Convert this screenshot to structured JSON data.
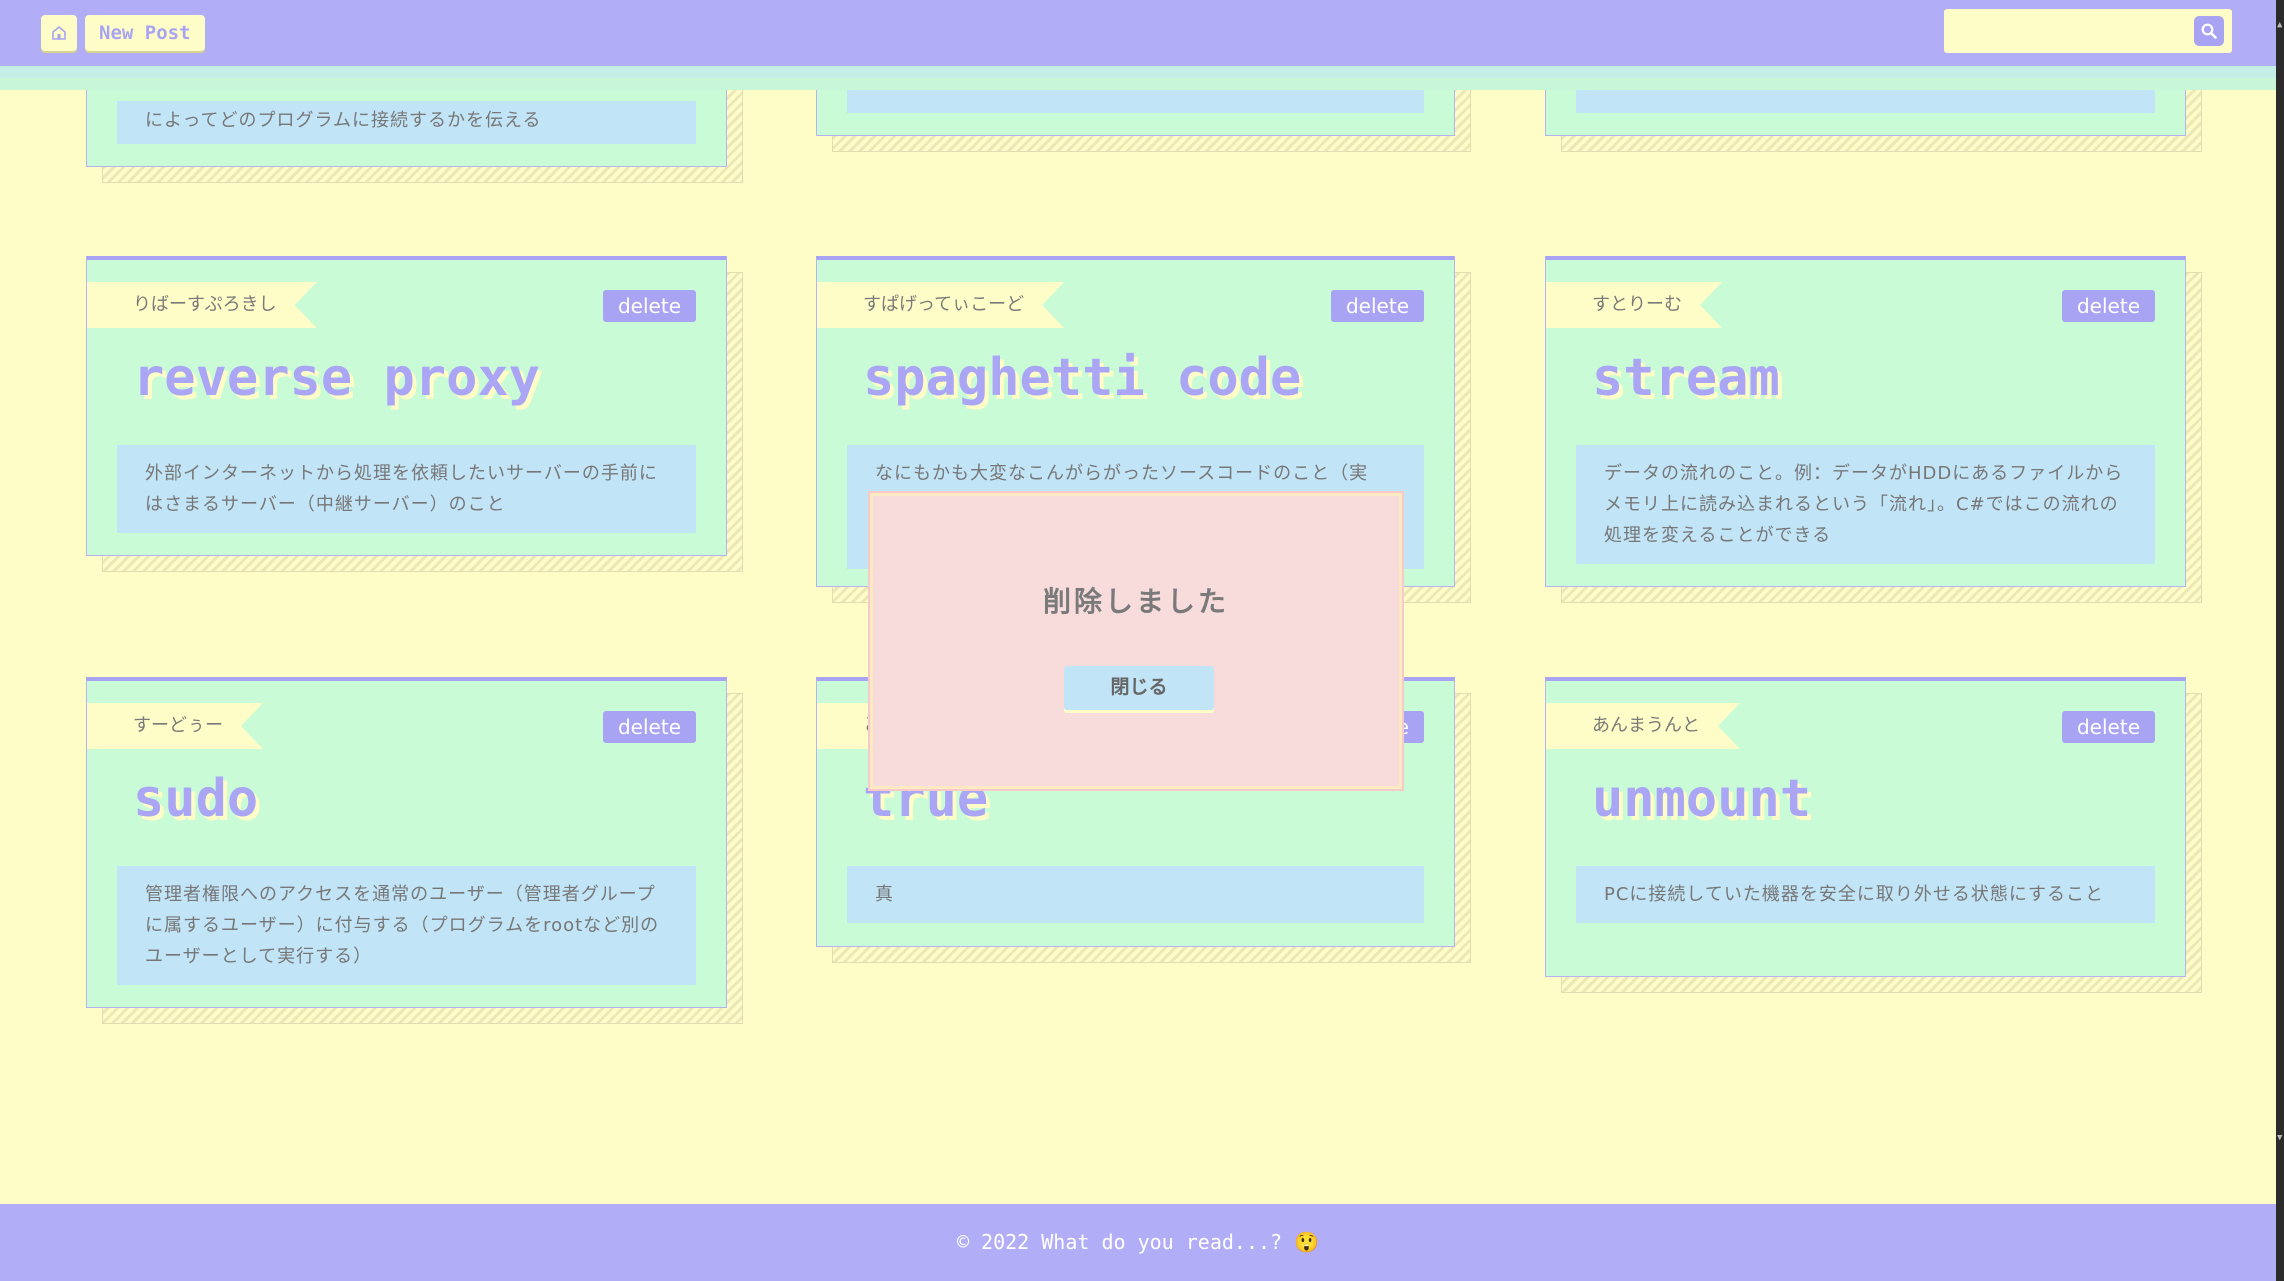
{
  "header": {
    "home_icon": "home-icon",
    "new_post_label": "New Post",
    "search": {
      "value": "",
      "placeholder": ""
    },
    "search_icon": "search-icon"
  },
  "top_row": [
    {
      "description": "によってどのプログラムに接続するかを伝える"
    },
    {
      "description": ""
    },
    {
      "description": ""
    }
  ],
  "cards": [
    {
      "reading": "りばーすぷろきし",
      "term": "reverse proxy",
      "delete_label": "delete",
      "description": "外部インターネットから処理を依頼したいサーバーの手前にはさまるサーバー（中継サーバー）のこと"
    },
    {
      "reading": "すぱげってぃこーど",
      "term": "spaghetti code",
      "delete_label": "delete",
      "description": "なにもかも大変なこんがらがったソースコードのこと（実"
    },
    {
      "reading": "すとりーむ",
      "term": "stream",
      "delete_label": "delete",
      "description": "データの流れのこと。例：データがHDDにあるファイルからメモリ上に読み込まれるという「流れ」。C#ではこの流れの処理を変えることができる"
    },
    {
      "reading": "すーどぅー",
      "term": "sudo",
      "delete_label": "delete",
      "description": "管理者権限へのアクセスを通常のユーザー（管理者グループに属するユーザー）に付与する（プログラムをrootなど別のユーザーとして実行する）"
    },
    {
      "reading": "と",
      "term": "true",
      "delete_label": "delete",
      "description": "真"
    },
    {
      "reading": "あんまうんと",
      "term": "unmount",
      "delete_label": "delete",
      "description": "PCに接続していた機器を安全に取り外せる状態にすること"
    }
  ],
  "modal": {
    "message": "削除しました",
    "close_label": "閉じる"
  },
  "footer": {
    "text": "© 2022 What do you read...? 😲"
  },
  "colors": {
    "background": "#fefdc8",
    "header": "#b1aef7",
    "card": "#c9fbd7",
    "accent": "#a8a4f3",
    "description": "#c1e4f7",
    "modal": "#f8dcdc"
  }
}
